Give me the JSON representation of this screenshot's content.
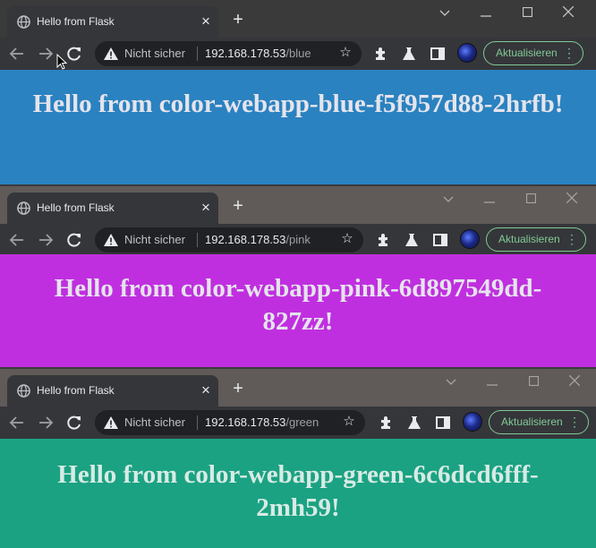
{
  "windows": [
    {
      "tab_title": "Hello from Flask",
      "security_text": "Nicht sicher",
      "url_host": "192.168.178.53",
      "url_path": "/blue",
      "update_label": "Aktualisieren",
      "heading": "Hello from color-webapp-blue-f5f957d88-2hrfb!",
      "page_color": "#2a82c0"
    },
    {
      "tab_title": "Hello from Flask",
      "security_text": "Nicht sicher",
      "url_host": "192.168.178.53",
      "url_path": "/pink",
      "update_label": "Aktualisieren",
      "heading": "Hello from color-webapp-pink-6d897549dd-827zz!",
      "page_color": "#c02fdf"
    },
    {
      "tab_title": "Hello from Flask",
      "security_text": "Nicht sicher",
      "url_host": "192.168.178.53",
      "url_path": "/green",
      "update_label": "Aktualisieren",
      "heading": "Hello from color-webapp-green-6c6dcd6fff-2mh59!",
      "page_color": "#1ba283"
    }
  ],
  "icons": {
    "tab": "globe-icon",
    "tab_close": "close-icon",
    "new_tab": "plus-icon",
    "back": "arrow-left-icon",
    "forward": "arrow-right-icon",
    "reload": "reload-icon",
    "security": "warning-icon",
    "bookmark": "star-icon",
    "extensions": "puzzle-icon",
    "labs": "flask-icon",
    "side_panel": "side-panel-icon",
    "profile": "avatar",
    "menu": "kebab-menu-icon"
  }
}
